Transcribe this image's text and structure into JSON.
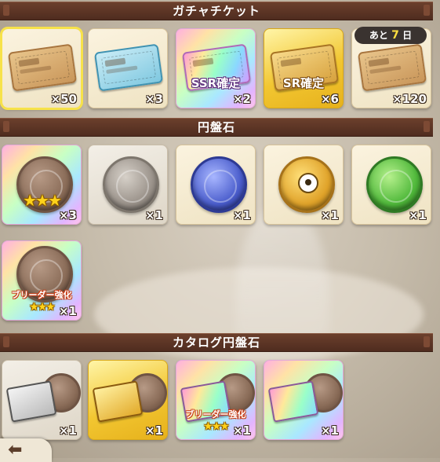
{
  "sections": [
    {
      "title": "ガチャチケット"
    },
    {
      "title": "円盤石"
    },
    {
      "title": "カタログ円盤石"
    }
  ],
  "tickets": [
    {
      "name": "gacha-ticket",
      "count": "×50",
      "label": ""
    },
    {
      "name": "blue-ticket",
      "count": "×3",
      "label": ""
    },
    {
      "name": "ssr-ticket",
      "count": "×2",
      "label": "SSR確定"
    },
    {
      "name": "sr-ticket",
      "count": "×6",
      "label": "SR確定"
    },
    {
      "name": "event-ticket",
      "count": "×120",
      "label": ""
    }
  ],
  "time_badge": {
    "prefix": "あと",
    "number": "7",
    "suffix": "日"
  },
  "discs": [
    {
      "name": "bronze-disc-3star",
      "count": "×3",
      "stars": "★★★"
    },
    {
      "name": "stone-disc",
      "count": "×1"
    },
    {
      "name": "blue-disc",
      "count": "×1"
    },
    {
      "name": "eye-disc",
      "count": "×1"
    },
    {
      "name": "green-disc",
      "count": "×1"
    },
    {
      "name": "breeder-disc",
      "count": "×1",
      "label": "ブリーダー強化",
      "stars": "★★★"
    }
  ],
  "catalog": [
    {
      "name": "silver-catalog",
      "count": "×1"
    },
    {
      "name": "gold-catalog",
      "count": "×1"
    },
    {
      "name": "breeder-catalog",
      "count": "×1",
      "label": "ブリーダー強化",
      "stars": "★★★"
    },
    {
      "name": "event-catalog",
      "count": "×1"
    }
  ],
  "back": {
    "icon": "back-arrow-icon"
  }
}
